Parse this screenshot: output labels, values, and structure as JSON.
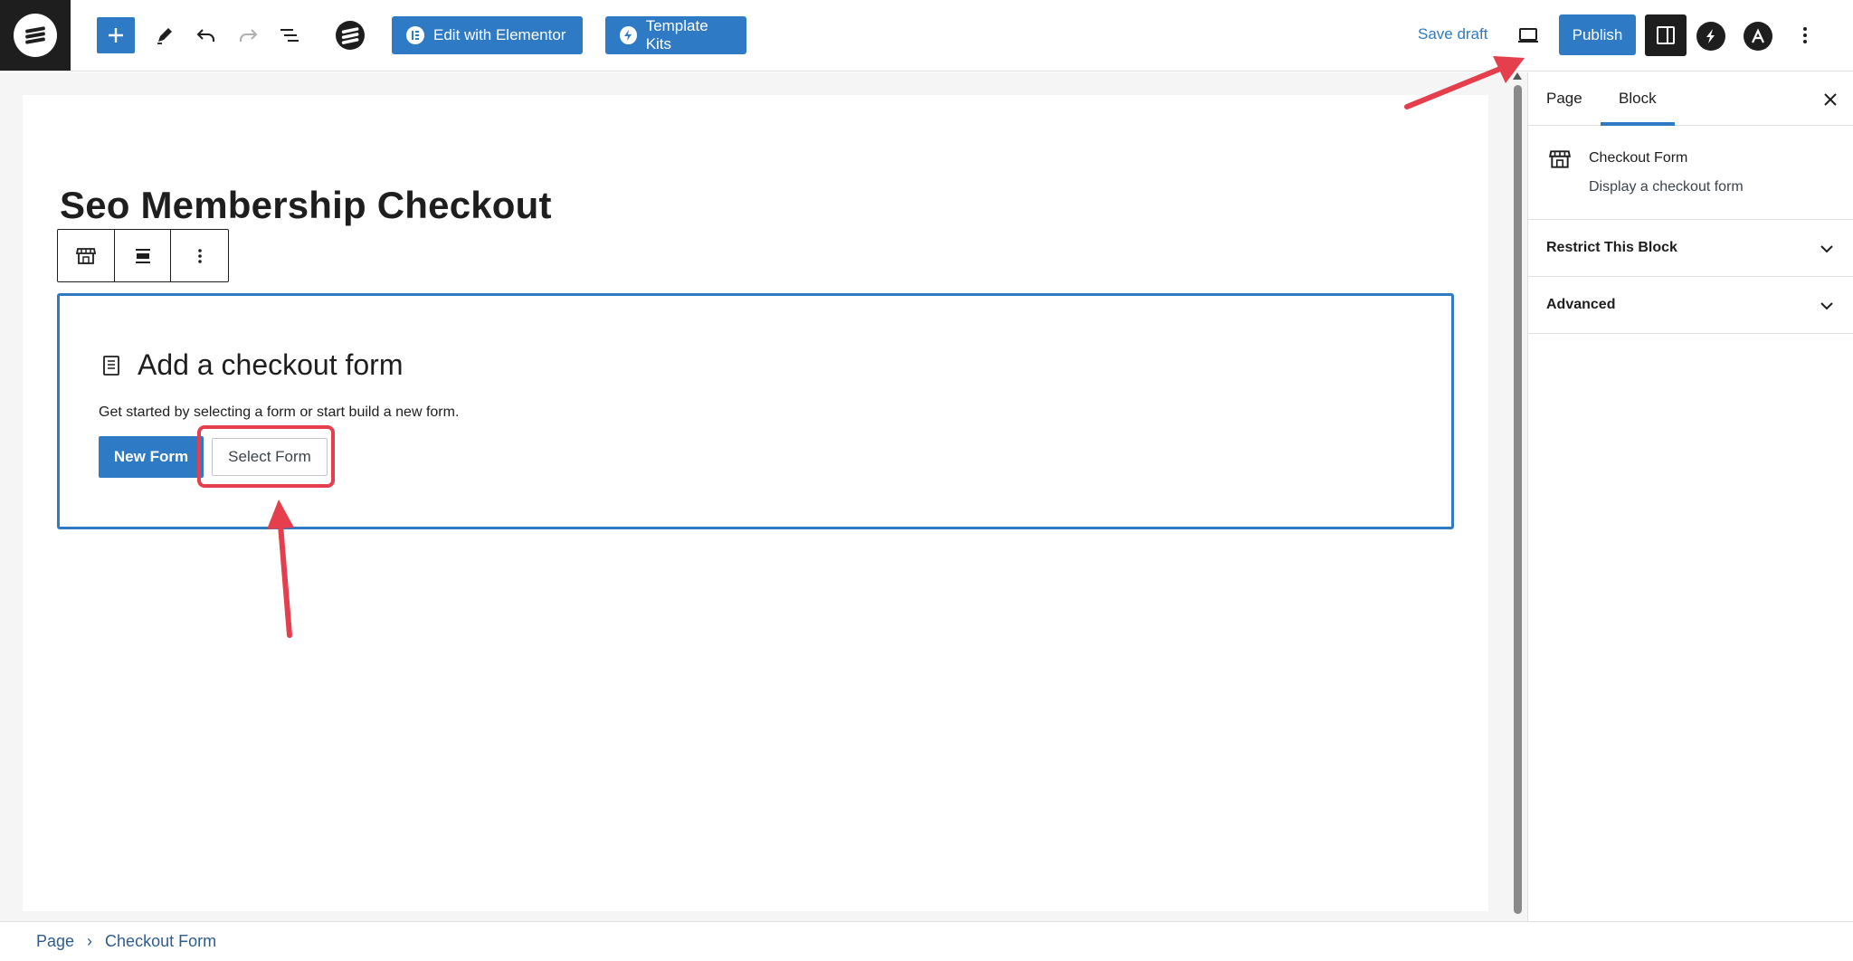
{
  "toolbar": {
    "edit_elementor_label": "Edit with Elementor",
    "template_kits_label": "Template Kits",
    "save_draft_label": "Save draft",
    "publish_label": "Publish",
    "icons": [
      "site-logo-icon",
      "add-block-icon",
      "pen-tool-icon",
      "undo-icon",
      "redo-icon",
      "document-overview-icon",
      "elementor-e-icon",
      "spectra-icon",
      "astra-icon",
      "more-options-icon"
    ]
  },
  "editor": {
    "page_title": "Seo Membership Checkout",
    "placeholder": {
      "title": "Add a checkout form",
      "description": "Get started by selecting a form or start build a new form.",
      "new_form_label": "New Form",
      "select_form_label": "Select Form"
    }
  },
  "sidebar": {
    "tabs": [
      {
        "label": "Page"
      },
      {
        "label": "Block",
        "active": true
      }
    ],
    "block": {
      "title": "Checkout Form",
      "description": "Display a checkout form"
    },
    "panels": [
      {
        "title": "Restrict This Block"
      },
      {
        "title": "Advanced"
      }
    ]
  },
  "breadcrumb": {
    "items": [
      "Page",
      "Checkout Form"
    ],
    "separator": "›"
  },
  "colors": {
    "accent": "#2f7ac5",
    "highlight": "#e53e4c",
    "dark": "#1e1e1e"
  }
}
